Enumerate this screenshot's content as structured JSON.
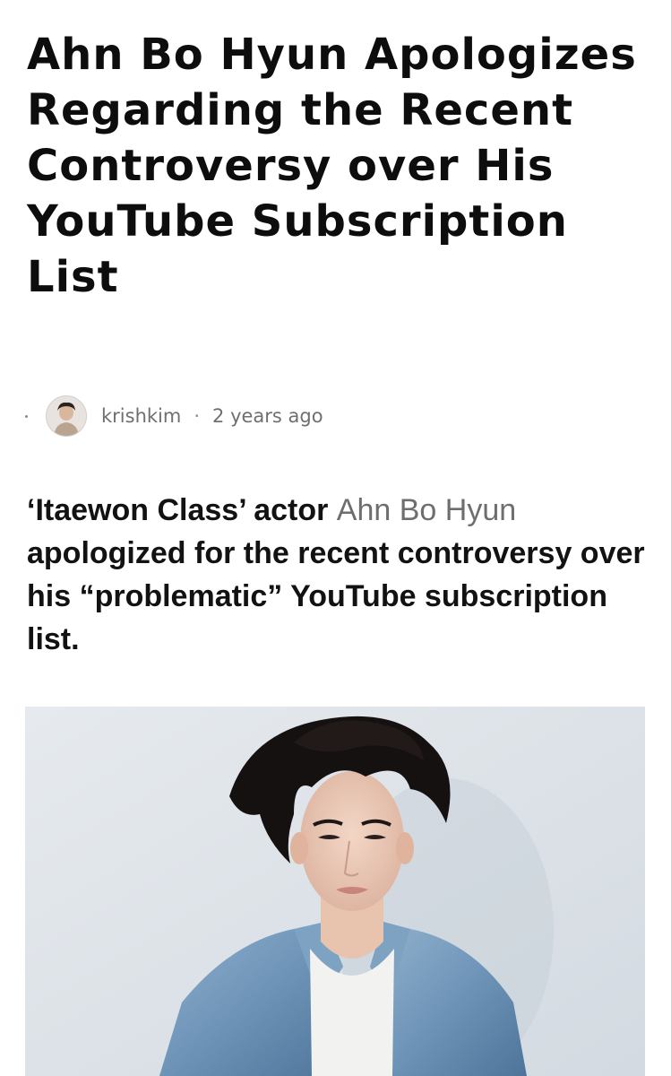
{
  "article": {
    "title": "Ahn Bo Hyun Apologizes Regarding the Recent Controversy over His YouTube Subscription List",
    "author": "krishkim",
    "separator": "·",
    "published": "2 years ago",
    "lede": {
      "prefix": "‘Itaewon Class’ actor ",
      "link_text": "Ahn Bo Hyun",
      "suffix": " apologized for the recent controversy over his “problematic” YouTube subscription list."
    },
    "hero_image": "photo-of-actor-in-denim-jacket"
  },
  "colors": {
    "text": "#121212",
    "muted": "#6e6e6e",
    "background": "#ffffff"
  }
}
